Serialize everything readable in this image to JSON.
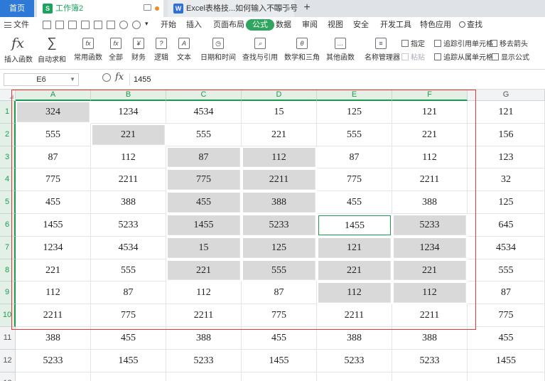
{
  "tabs": {
    "home": "首页",
    "docs": [
      {
        "label": "工作簿2",
        "icon": "S",
        "active": true
      },
      {
        "label": "Excel表格技...如何输入不等于号",
        "icon": "W",
        "active": false
      }
    ],
    "add": "+"
  },
  "menu": {
    "file": "文件",
    "items": [
      "开始",
      "插入",
      "页面布局",
      "公式",
      "数据",
      "审阅",
      "视图",
      "安全",
      "开发工具",
      "特色应用"
    ],
    "active": "公式",
    "search": "查找"
  },
  "ribbon": {
    "insert_function": "插入函数",
    "buttons": [
      "自动求和",
      "常用函数",
      "全部",
      "财务",
      "逻辑",
      "文本",
      "日期和时间",
      "查找与引用",
      "数学和三角",
      "其他函数"
    ],
    "name_manager": "名称管理器",
    "specify": "指定",
    "paste": "粘贴",
    "trace_precedents": "追踪引用单元格",
    "trace_dependents": "追踪从属单元格",
    "remove_arrows": "移去箭头",
    "show_formulas": "显示公式"
  },
  "formula_bar": {
    "cell_ref": "E6",
    "fx": "fx",
    "value": "1455"
  },
  "grid": {
    "columns": [
      "A",
      "B",
      "C",
      "D",
      "E",
      "F",
      "G"
    ],
    "selected_columns": [
      "A",
      "B",
      "C",
      "D",
      "E",
      "F"
    ],
    "rows": [
      {
        "n": "1",
        "cells": [
          "324",
          "1234",
          "4534",
          "15",
          "125",
          "121",
          "121"
        ]
      },
      {
        "n": "2",
        "cells": [
          "555",
          "221",
          "555",
          "221",
          "555",
          "221",
          "156"
        ]
      },
      {
        "n": "3",
        "cells": [
          "87",
          "112",
          "87",
          "112",
          "87",
          "112",
          "123"
        ]
      },
      {
        "n": "4",
        "cells": [
          "775",
          "2211",
          "775",
          "2211",
          "775",
          "2211",
          "32"
        ]
      },
      {
        "n": "5",
        "cells": [
          "455",
          "388",
          "455",
          "388",
          "455",
          "388",
          "125"
        ]
      },
      {
        "n": "6",
        "cells": [
          "1455",
          "5233",
          "1455",
          "5233",
          "1455",
          "5233",
          "645"
        ]
      },
      {
        "n": "7",
        "cells": [
          "1234",
          "4534",
          "15",
          "125",
          "121",
          "1234",
          "4534"
        ]
      },
      {
        "n": "8",
        "cells": [
          "221",
          "555",
          "221",
          "555",
          "221",
          "221",
          "555"
        ]
      },
      {
        "n": "9",
        "cells": [
          "112",
          "87",
          "112",
          "87",
          "112",
          "112",
          "87"
        ]
      },
      {
        "n": "10",
        "cells": [
          "2211",
          "775",
          "2211",
          "775",
          "2211",
          "2211",
          "775"
        ]
      },
      {
        "n": "11",
        "cells": [
          "388",
          "455",
          "388",
          "455",
          "388",
          "388",
          "455"
        ]
      },
      {
        "n": "12",
        "cells": [
          "5233",
          "1455",
          "5233",
          "1455",
          "5233",
          "5233",
          "1455"
        ]
      },
      {
        "n": "13",
        "cells": [
          "",
          "",
          "",
          "",
          "",
          "",
          ""
        ]
      }
    ],
    "highlighted_cells": [
      "A1",
      "B2",
      "C3",
      "C4",
      "C5",
      "C6",
      "C7",
      "C8",
      "D3",
      "D4",
      "D5",
      "D6",
      "D7",
      "D8",
      "E7",
      "E8",
      "E9",
      "F6",
      "F7",
      "F8",
      "F9"
    ],
    "active_cell": "E6",
    "highlight_color": "#d9d9d9",
    "selection_color": "#1e9a4e",
    "box_color": "#e53935"
  }
}
